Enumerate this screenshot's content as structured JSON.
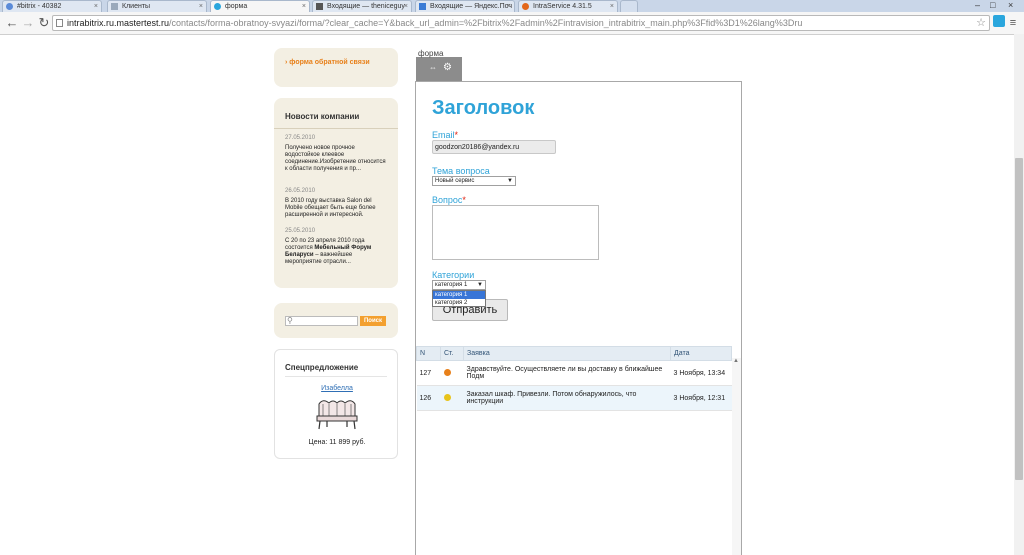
{
  "browser": {
    "tabs": [
      {
        "label": "#bitrix - 40382",
        "active": false,
        "color": "#5b8bd8"
      },
      {
        "label": "Клиенты",
        "active": false,
        "color": "#9aa9bb"
      },
      {
        "label": "форма",
        "active": true,
        "color": "#2aa6dd"
      },
      {
        "label": "Входящие — theniceguy",
        "active": false,
        "color": "#555555"
      },
      {
        "label": "Входящие — Яндекс.Поч",
        "active": false,
        "color": "#3a7bd5"
      },
      {
        "label": "IntraService 4.31.5",
        "active": false,
        "color": "#e2661a"
      }
    ],
    "url_host": "intrabitrix.ru.mastertest.ru",
    "url_path": "/contacts/forma-obratnoy-svyazi/forma/?clear_cache=Y&back_url_admin=%2Fbitrix%2Fadmin%2Fintravision_intrabitrix_main.php%3Ffid%3D1%26lang%3Dru"
  },
  "sidebar": {
    "link": "форма обратной связи",
    "news": {
      "title": "Новости компании",
      "items": [
        {
          "date": "27.05.2010",
          "text": "Получено новое прочное водостойкое клеевое соединение.Изобретение относится к области получения и пр..."
        },
        {
          "date": "26.05.2010",
          "text": "В 2010 году выставка Salon del Mobile обещает быть еще более расширенной и интересной."
        },
        {
          "date": "25.05.2010",
          "text": "С 20 по 23 апреля 2010 года состоится Мебельный Форум Беларуси – важнейшее мероприятие отрасли..."
        }
      ]
    },
    "search_button": "Поиск",
    "special": {
      "title": "Спецпредложение",
      "product": "Изабелла",
      "price": "Цена: 11 899 руб."
    }
  },
  "form": {
    "panel_title": "форма",
    "heading": "Заголовок",
    "email_label": "Email",
    "email_value": "goodzon20186@yandex.ru",
    "topic_label": "Тема вопроса",
    "topic_value": "Новый сервис",
    "question_label": "Вопрос",
    "category_label": "Категории",
    "category_value": "категория 1",
    "category_options": [
      "категория 1",
      "категория 2"
    ],
    "submit": "Отправить",
    "required_mark": "*"
  },
  "grid": {
    "headers": [
      "N",
      "Ст.",
      "Заявка",
      "Дата"
    ],
    "rows": [
      {
        "n": "127",
        "status_color": "#e8801a",
        "text": "Здравствуйте. Осуществляете ли вы доставку в ближайшее Подм",
        "date": "3 Ноября, 13:34"
      },
      {
        "n": "126",
        "status_color": "#e8c31a",
        "text": "Заказал шкаф. Привезли. Потом обнаружилось, что инструкции",
        "date": "3 Ноября, 12:31"
      }
    ]
  }
}
